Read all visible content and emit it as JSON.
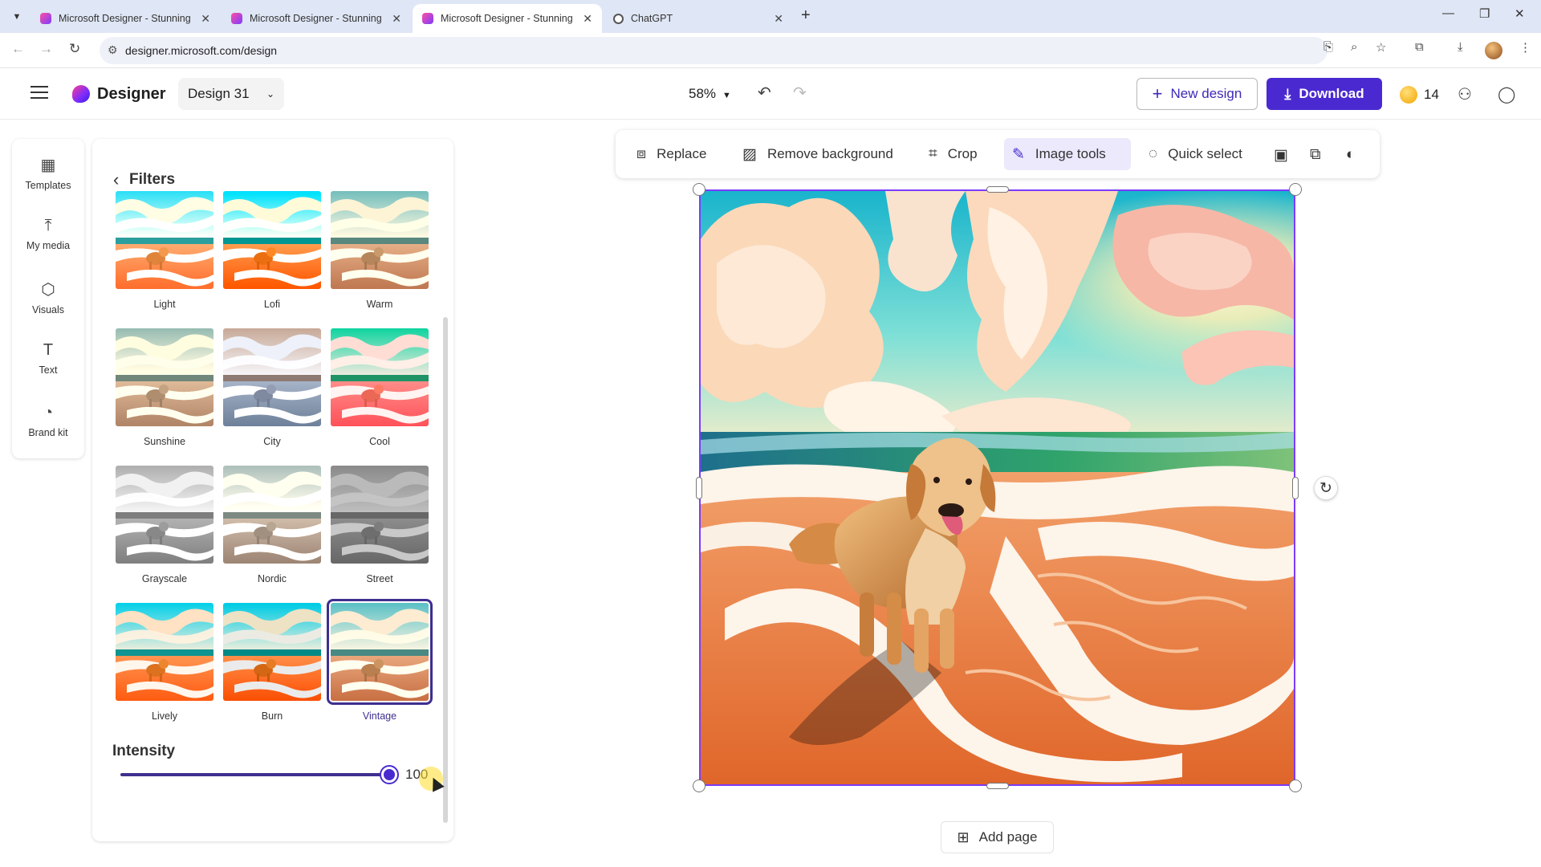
{
  "browser": {
    "tabs": [
      {
        "title": "Microsoft Designer - Stunning",
        "active": false
      },
      {
        "title": "Microsoft Designer - Stunning",
        "active": false
      },
      {
        "title": "Microsoft Designer - Stunning",
        "active": true
      },
      {
        "title": "ChatGPT",
        "active": false
      }
    ],
    "url": "designer.microsoft.com/design"
  },
  "header": {
    "brand": "Designer",
    "design_name": "Design 31",
    "zoom": "58%",
    "new_design_label": "New design",
    "download_label": "Download",
    "credits": "14"
  },
  "rail": {
    "items": [
      {
        "label": "Templates",
        "icon": "templates-icon"
      },
      {
        "label": "My media",
        "icon": "upload-icon"
      },
      {
        "label": "Visuals",
        "icon": "visuals-icon"
      },
      {
        "label": "Text",
        "icon": "text-icon"
      },
      {
        "label": "Brand kit",
        "icon": "palette-icon"
      }
    ]
  },
  "filters_panel": {
    "title": "Filters",
    "filters": [
      {
        "label": "Light",
        "selected": false
      },
      {
        "label": "Lofi",
        "selected": false
      },
      {
        "label": "Warm",
        "selected": false
      },
      {
        "label": "Sunshine",
        "selected": false
      },
      {
        "label": "City",
        "selected": false
      },
      {
        "label": "Cool",
        "selected": false
      },
      {
        "label": "Grayscale",
        "selected": false
      },
      {
        "label": "Nordic",
        "selected": false
      },
      {
        "label": "Street",
        "selected": false
      },
      {
        "label": "Lively",
        "selected": false
      },
      {
        "label": "Burn",
        "selected": false
      },
      {
        "label": "Vintage",
        "selected": true
      }
    ],
    "intensity_label": "Intensity",
    "intensity_value": "100"
  },
  "image_toolbar": {
    "replace": "Replace",
    "remove_background": "Remove background",
    "crop": "Crop",
    "image_tools": "Image tools",
    "quick_select": "Quick select"
  },
  "canvas": {
    "add_page_label": "Add page"
  },
  "colors": {
    "accent": "#4a2ad0",
    "selected_outline": "#3e2f8f",
    "image_tools_bg": "#ebe9fb"
  }
}
